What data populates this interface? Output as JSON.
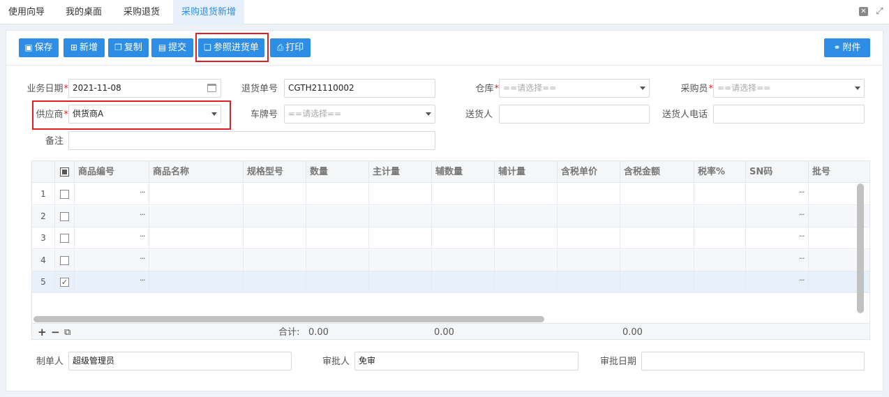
{
  "tabs": [
    "使用向导",
    "我的桌面",
    "采购退货",
    "采购退货新增"
  ],
  "toolbar": {
    "save": "保存",
    "add": "新增",
    "copy": "复制",
    "submit": "提交",
    "reference": "参照进货单",
    "print": "打印",
    "attachment": "附件"
  },
  "icons": {
    "save": "floppy-icon",
    "add": "plus-square-icon",
    "copy": "copy-icon",
    "submit": "document-icon",
    "reference": "copy-doc-icon",
    "print": "printer-icon",
    "attachment": "link-icon"
  },
  "accent_color": "#2e8de4",
  "highlight_color": "#e02020",
  "form": {
    "business_date_label": "业务日期",
    "business_date_value": "2021-11-08",
    "return_no_label": "退货单号",
    "return_no_value": "CGTH21110002",
    "warehouse_label": "仓库",
    "warehouse_placeholder": "==请选择==",
    "buyer_label": "采购员",
    "buyer_placeholder": "==请选择==",
    "supplier_label": "供应商",
    "supplier_value": "供货商A",
    "plate_label": "车牌号",
    "plate_placeholder": "==请选择==",
    "deliverer_label": "送货人",
    "deliverer_value": "",
    "deliverer_phone_label": "送货人电话",
    "deliverer_phone_value": "",
    "remark_label": "备注",
    "remark_value": ""
  },
  "grid": {
    "columns": [
      "商品编号",
      "商品名称",
      "规格型号",
      "数量",
      "主计量",
      "辅数量",
      "辅计量",
      "含税单价",
      "含税金额",
      "税率%",
      "SN码",
      "批号"
    ],
    "rows": [
      {
        "num": "1",
        "checked": false
      },
      {
        "num": "2",
        "checked": false
      },
      {
        "num": "3",
        "checked": false
      },
      {
        "num": "4",
        "checked": false
      },
      {
        "num": "5",
        "checked": true
      }
    ],
    "footer": {
      "total_label": "合计:",
      "qty_total": "0.00",
      "aux_total": "0.00",
      "amount_total": "0.00"
    }
  },
  "bottom": {
    "maker_label": "制单人",
    "maker_value": "超级管理员",
    "approver_label": "审批人",
    "approver_value": "免审",
    "approve_date_label": "审批日期",
    "approve_date_value": ""
  }
}
